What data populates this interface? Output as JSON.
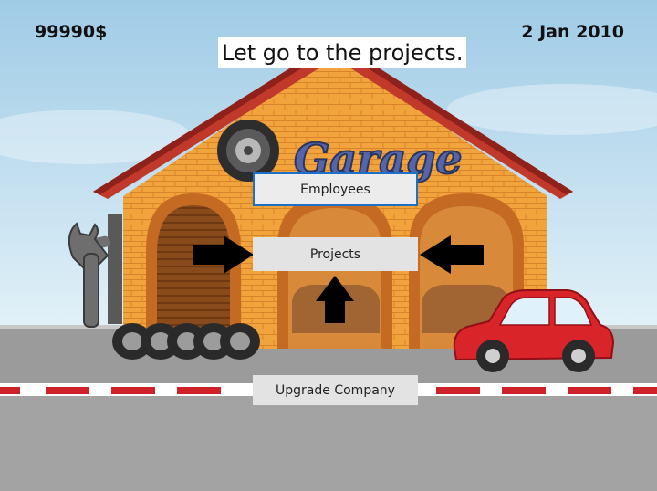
{
  "hud": {
    "money": "99990$",
    "date": "2 Jan 2010"
  },
  "tutorial_hint": "Let go to the projects.",
  "sign_text": "Garage",
  "menu": {
    "employees_label": "Employees",
    "projects_label": "Projects",
    "upgrade_label": "Upgrade Company"
  },
  "colors": {
    "sky": "#b9dcef",
    "brick": "#f0a23a",
    "roof": "#c0392b",
    "road": "#9a9a9a",
    "car": "#d9242a",
    "button_selected_border": "#1e6fc7"
  }
}
